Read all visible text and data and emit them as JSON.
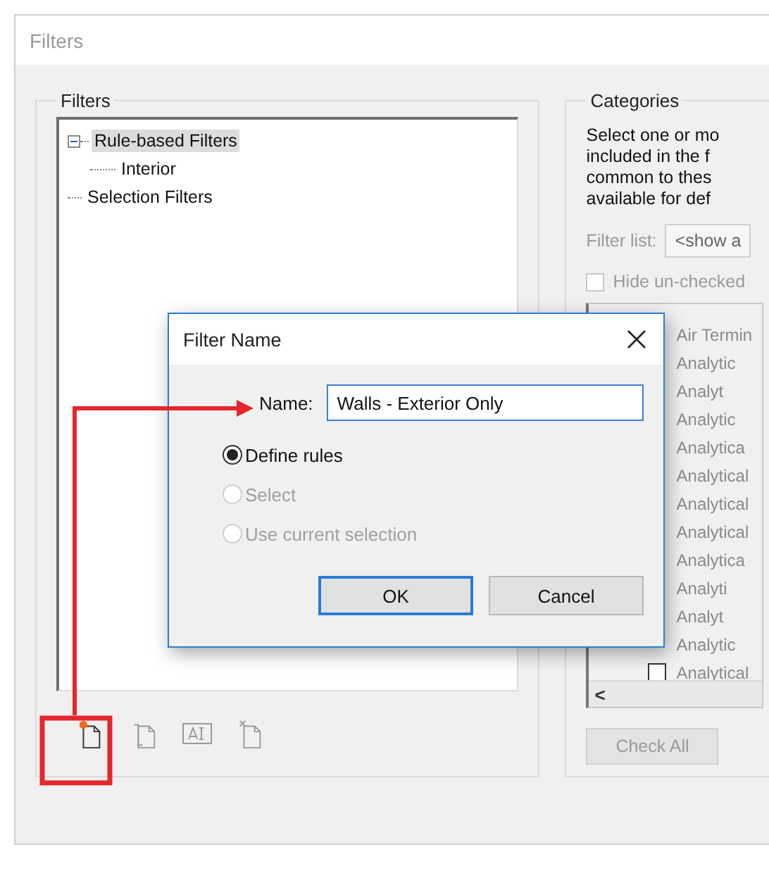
{
  "window": {
    "title": "Filters"
  },
  "filters": {
    "title": "Filters",
    "tree": [
      {
        "label": "Rule-based Filters",
        "selected": true,
        "expanded": true,
        "children": [
          {
            "label": "Interior",
            "selected": false
          }
        ]
      },
      {
        "label": "Selection Filters",
        "selected": false
      }
    ],
    "tools": [
      {
        "kind": "new",
        "disabled": false
      },
      {
        "kind": "duplicate",
        "disabled": true
      },
      {
        "kind": "rename",
        "disabled": true
      },
      {
        "kind": "delete",
        "disabled": true
      }
    ]
  },
  "categories": {
    "title": "Categories",
    "description": [
      "Select one or mo",
      "included in the f",
      "common to thes",
      "available for def"
    ],
    "filter_label": "Filter list:",
    "filter_value": "<show a",
    "hide_unchecked": {
      "label": "Hide un-checked",
      "checked": false
    },
    "items": [
      {
        "label": "Air Termin"
      },
      {
        "label": "Analytic"
      },
      {
        "label": "Analyt"
      },
      {
        "label": "Analytic"
      },
      {
        "label": "Analytica"
      },
      {
        "label": "Analytical"
      },
      {
        "label": "Analytical"
      },
      {
        "label": "Analytical"
      },
      {
        "label": "Analytica"
      },
      {
        "label": "Analyti"
      },
      {
        "label": "Analyt"
      },
      {
        "label": "Analytic"
      },
      {
        "label": "Analytical",
        "checked": false
      }
    ],
    "scroll_left": "<",
    "check_all": "Check All"
  },
  "dialog": {
    "title": "Filter Name",
    "name_label": "Name:",
    "name_value": "Walls - Exterior Only",
    "options": [
      {
        "label": "Define rules",
        "selected": true,
        "disabled": false
      },
      {
        "label": "Select",
        "selected": false,
        "disabled": true
      },
      {
        "label": "Use current selection",
        "selected": false,
        "disabled": true
      }
    ],
    "buttons": [
      {
        "label": "OK",
        "default": true
      },
      {
        "label": "Cancel",
        "default": false
      }
    ]
  }
}
